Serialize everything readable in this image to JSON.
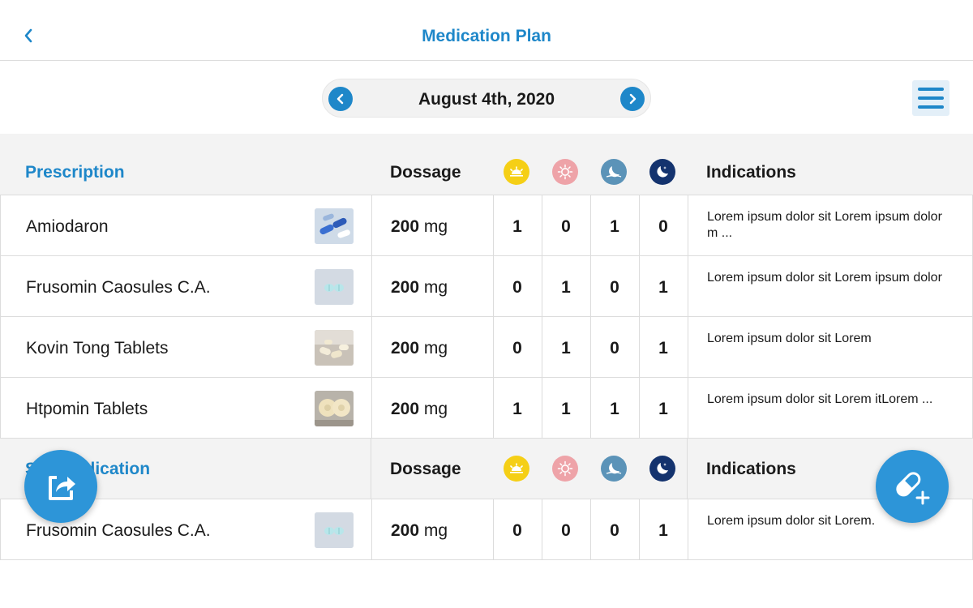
{
  "header": {
    "title": "Medication Plan",
    "back_icon": "chevron-left-icon"
  },
  "date_nav": {
    "date": "August 4th, 2020",
    "prev_icon": "chevron-left-icon",
    "next_icon": "chevron-right-icon"
  },
  "menu_icon": "menu-icon",
  "colors": {
    "accent": "#1e87c9",
    "morning": "#f5cf16",
    "noon": "#eea3a8",
    "evening": "#5b93b8",
    "night": "#14336e"
  },
  "columns": {
    "dossage": "Dossage",
    "indications": "Indications",
    "time_icons": [
      "sunrise-icon",
      "sun-icon",
      "moon-icon",
      "night-moon-icon"
    ]
  },
  "prescription": {
    "title": "Prescription",
    "rows": [
      {
        "name": "Amiodaron",
        "dose_value": "200",
        "dose_unit": "mg",
        "counts": [
          "1",
          "0",
          "1",
          "0"
        ],
        "indication": "Lorem ipsum dolor sit Lorem ipsum dolor m ..."
      },
      {
        "name": "Frusomin Caosules C.A.",
        "dose_value": "200",
        "dose_unit": "mg",
        "counts": [
          "0",
          "1",
          "0",
          "1"
        ],
        "indication": "Lorem ipsum dolor sit Lorem ipsum dolor"
      },
      {
        "name": "Kovin Tong Tablets",
        "dose_value": "200",
        "dose_unit": "mg",
        "counts": [
          "0",
          "1",
          "0",
          "1"
        ],
        "indication": "Lorem ipsum dolor sit Lorem"
      },
      {
        "name": "Htpomin Tablets",
        "dose_value": "200",
        "dose_unit": "mg",
        "counts": [
          "1",
          "1",
          "1",
          "1"
        ],
        "indication": "Lorem ipsum dolor sit Lorem itLorem ..."
      }
    ]
  },
  "self_medication": {
    "title": "Self Medication",
    "rows": [
      {
        "name": "Frusomin Caosules C.A.",
        "dose_value": "200",
        "dose_unit": "mg",
        "counts": [
          "0",
          "0",
          "0",
          "1"
        ],
        "indication": "Lorem ipsum dolor sit Lorem."
      }
    ]
  },
  "fabs": {
    "share_icon": "share-icon",
    "add_icon": "add-pill-icon"
  }
}
